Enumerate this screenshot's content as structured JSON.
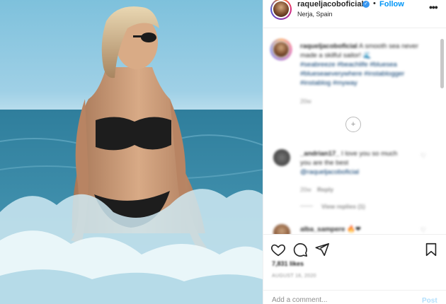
{
  "post": {
    "image_alt": "Woman in black bikini kneeling in sea waves wearing sunglasses"
  },
  "header": {
    "username": "raqueljacoboficial",
    "separator": "•",
    "follow_label": "Follow",
    "location": "Nerja, Spain",
    "more_glyph": "•••"
  },
  "comments": {
    "caption": {
      "username": "raqueljacoboficial",
      "text": "A smooth sea never made a skilful sailor! 🌊",
      "tags_line1": "#seabreeze #beachlife #bluesea",
      "tags_line2": "#blueseaeverywhere #instablogger",
      "tags_line3": "#instablog #myway",
      "time": "20w"
    },
    "load_more_glyph": "+",
    "comment1": {
      "username": "_andrian17_",
      "text": "I love you so much",
      "text2": "you are the best",
      "mention": "@raqueljacoboficial",
      "time": "20w",
      "reply": "Reply",
      "view_replies": "View replies (1)"
    },
    "comment2": {
      "username": "alba_sampere",
      "text": "🔥❤"
    }
  },
  "actions": {
    "likes": "7,831 likes",
    "date": "AUGUST 16, 2020"
  },
  "add_comment": {
    "placeholder": "Add a comment...",
    "post_label": "Post"
  },
  "colors": {
    "accent": "#0095f6",
    "verified": "#3897f0",
    "muted": "#8e8e8e"
  }
}
